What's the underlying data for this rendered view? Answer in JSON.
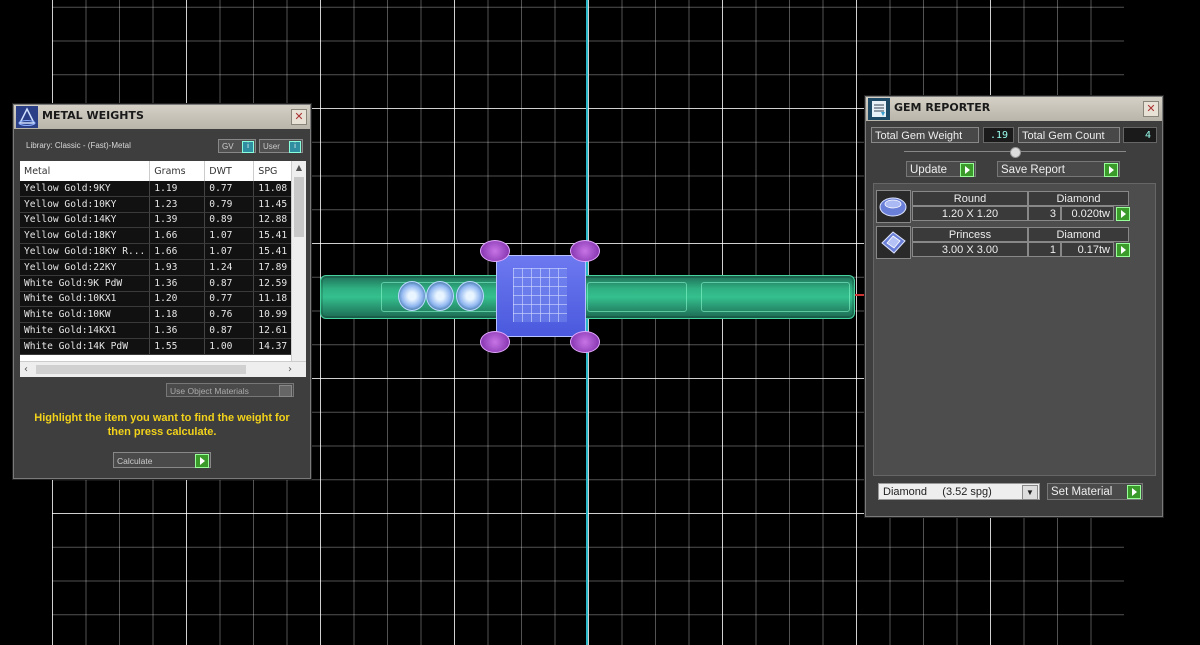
{
  "metal_weights": {
    "title": "METAL WEIGHTS",
    "library": "Library: Classic - (Fast)-Metal",
    "toggle_gv": "GV",
    "toggle_user": "User",
    "columns": [
      "Metal",
      "Grams",
      "DWT",
      "SPG"
    ],
    "rows": [
      [
        "Yellow Gold:9KY",
        "1.19",
        "0.77",
        "11.08"
      ],
      [
        "Yellow Gold:10KY",
        "1.23",
        "0.79",
        "11.45"
      ],
      [
        "Yellow Gold:14KY",
        "1.39",
        "0.89",
        "12.88"
      ],
      [
        "Yellow Gold:18KY",
        "1.66",
        "1.07",
        "15.41"
      ],
      [
        "Yellow Gold:18KY R...",
        "1.66",
        "1.07",
        "15.41"
      ],
      [
        "Yellow Gold:22KY",
        "1.93",
        "1.24",
        "17.89"
      ],
      [
        "White Gold:9K PdW",
        "1.36",
        "0.87",
        "12.59"
      ],
      [
        "White Gold:10KX1",
        "1.20",
        "0.77",
        "11.18"
      ],
      [
        "White Gold:10KW",
        "1.18",
        "0.76",
        "10.99"
      ],
      [
        "White Gold:14KX1",
        "1.36",
        "0.87",
        "12.61"
      ],
      [
        "White Gold:14K PdW",
        "1.55",
        "1.00",
        "14.37"
      ]
    ],
    "use_object_materials": "Use Object Materials",
    "hint": "Highlight the item you want to find the weight for then press calculate.",
    "calculate": "Calculate"
  },
  "gem_reporter": {
    "title": "GEM REPORTER",
    "total_weight_label": "Total Gem Weight",
    "total_weight_value": ".19",
    "total_count_label": "Total Gem Count",
    "total_count_value": "4",
    "update": "Update",
    "save_report": "Save Report",
    "gems": [
      {
        "shape": "Round",
        "material": "Diamond",
        "size": "1.20 X 1.20",
        "count": "3",
        "weight": "0.020tw"
      },
      {
        "shape": "Princess",
        "material": "Diamond",
        "size": "3.00 X 3.00",
        "count": "1",
        "weight": "0.17tw"
      }
    ],
    "material_select": "Diamond     (3.52 spg)",
    "set_material": "Set Material"
  },
  "colors": {
    "highlight_text": "#f2d21a",
    "action_green": "#3a9a2a",
    "band": "#35c08e",
    "stone": "#5664e6",
    "prongs": "#a64fd0"
  }
}
